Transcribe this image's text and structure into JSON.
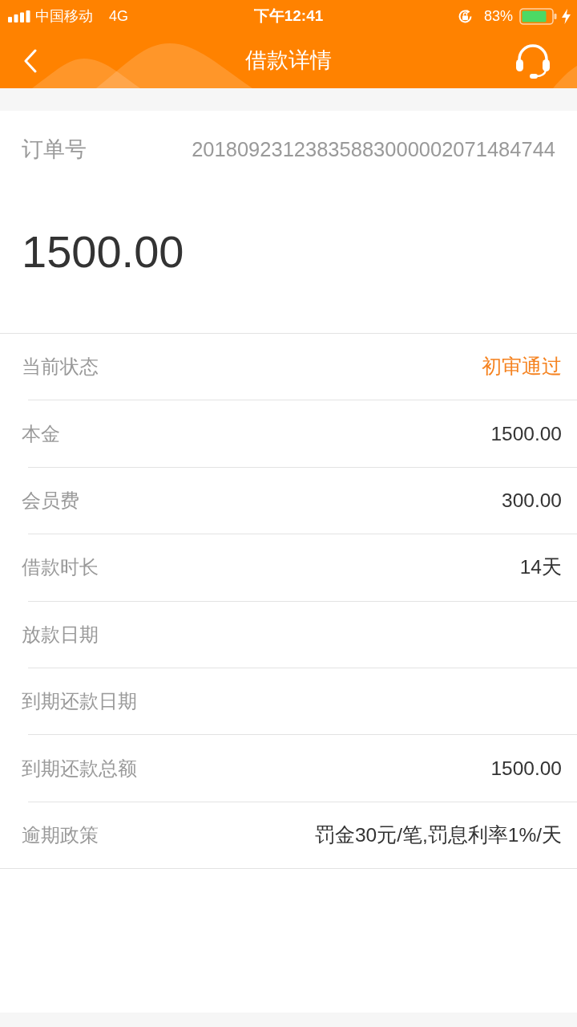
{
  "status_bar": {
    "carrier": "中国移动",
    "network": "4G",
    "time": "下午12:41",
    "battery_percent": "83%"
  },
  "header": {
    "title": "借款详情"
  },
  "order": {
    "label": "订单号",
    "number": "20180923123835883000002071484744",
    "amount": "1500.00"
  },
  "details": [
    {
      "kind": "status",
      "label": "当前状态",
      "value": "初审通过"
    },
    {
      "kind": "plain",
      "label": "本金",
      "value": "1500.00"
    },
    {
      "kind": "plain",
      "label": "会员费",
      "value": "300.00"
    },
    {
      "kind": "plain",
      "label": "借款时长",
      "value": "14天"
    },
    {
      "label": "放款日期"
    },
    {
      "label": "到期还款日期"
    },
    {
      "kind": "plain",
      "label": "到期还款总额",
      "value": "1500.00"
    },
    {
      "kind": "plain",
      "label": "逾期政策",
      "value": "罚金30元/笔,罚息利率1%/天"
    }
  ]
}
